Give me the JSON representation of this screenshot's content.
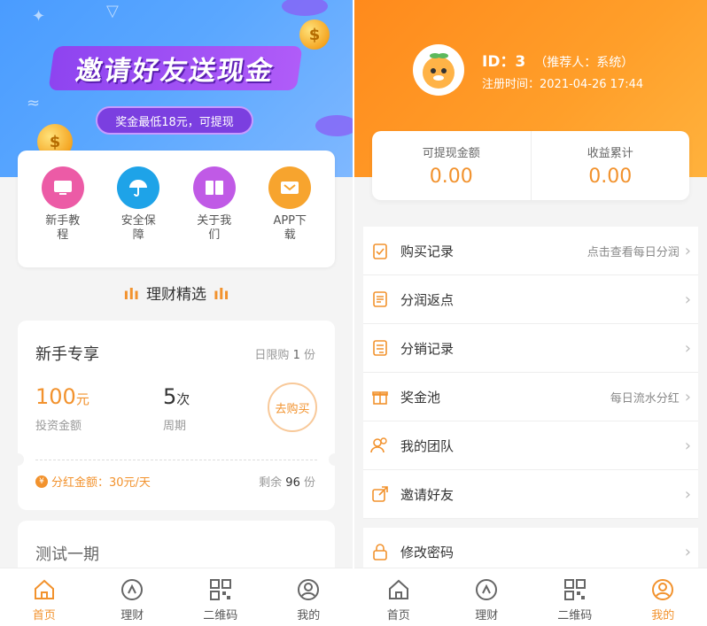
{
  "left": {
    "banner": {
      "title": "邀请好友送现金",
      "subtitle": "奖金最低18元，可提现"
    },
    "menu": [
      {
        "label": "新手教程",
        "icon": "monitor-icon",
        "color": "#ec5ba6"
      },
      {
        "label": "安全保障",
        "icon": "umbrella-icon",
        "color": "#1ea3e8"
      },
      {
        "label": "关于我们",
        "icon": "book-icon",
        "color": "#c05ae6"
      },
      {
        "label": "APP下载",
        "icon": "download-icon",
        "color": "#f7a42e"
      }
    ],
    "section_title": "理财精选",
    "product": {
      "name": "新手专享",
      "limit_prefix": "日限购",
      "limit_value": "1",
      "limit_suffix": "份",
      "amount": "100",
      "amount_unit": "元",
      "amount_label": "投资金额",
      "period": "5",
      "period_unit": "次",
      "period_label": "周期",
      "buy_label": "去购买",
      "dividend_icon_glyph": "¥",
      "dividend": "分红金额：30元/天",
      "remain_prefix": "剩余",
      "remain_value": "96",
      "remain_suffix": "份"
    },
    "product2": {
      "name": "测试一期"
    },
    "tabs": [
      {
        "label": "首页",
        "icon": "home-icon",
        "active": true
      },
      {
        "label": "理财",
        "icon": "finance-icon",
        "active": false
      },
      {
        "label": "二维码",
        "icon": "qrcode-icon",
        "active": false
      },
      {
        "label": "我的",
        "icon": "user-icon",
        "active": false
      }
    ]
  },
  "right": {
    "profile": {
      "id_text": "ID：3",
      "referrer": "（推荐人：系统）",
      "reg_time": "注册时间：2021-04-26 17:44"
    },
    "stats": [
      {
        "label": "可提现金额",
        "value": "0.00"
      },
      {
        "label": "收益累计",
        "value": "0.00"
      }
    ],
    "menu": [
      {
        "label": "购买记录",
        "hint": "点击查看每日分润",
        "icon": "clipboard-icon"
      },
      {
        "label": "分润返点",
        "hint": "",
        "icon": "document-icon"
      },
      {
        "label": "分销记录",
        "hint": "",
        "icon": "list-icon"
      },
      {
        "label": "奖金池",
        "hint": "每日流水分红",
        "icon": "gift-icon"
      },
      {
        "label": "我的团队",
        "hint": "",
        "icon": "team-icon"
      },
      {
        "label": "邀请好友",
        "hint": "",
        "icon": "share-icon"
      }
    ],
    "menu2": [
      {
        "label": "修改密码",
        "hint": "",
        "icon": "lock-icon"
      }
    ],
    "tabs": [
      {
        "label": "首页",
        "icon": "home-icon"
      },
      {
        "label": "理财",
        "icon": "finance-icon"
      },
      {
        "label": "二维码",
        "icon": "qrcode-icon"
      },
      {
        "label": "我的",
        "icon": "user-icon"
      }
    ]
  },
  "colors": {
    "accent": "#f2922d",
    "banner_blue": "#5aa7ff",
    "header_orange": "#ff9a26"
  }
}
